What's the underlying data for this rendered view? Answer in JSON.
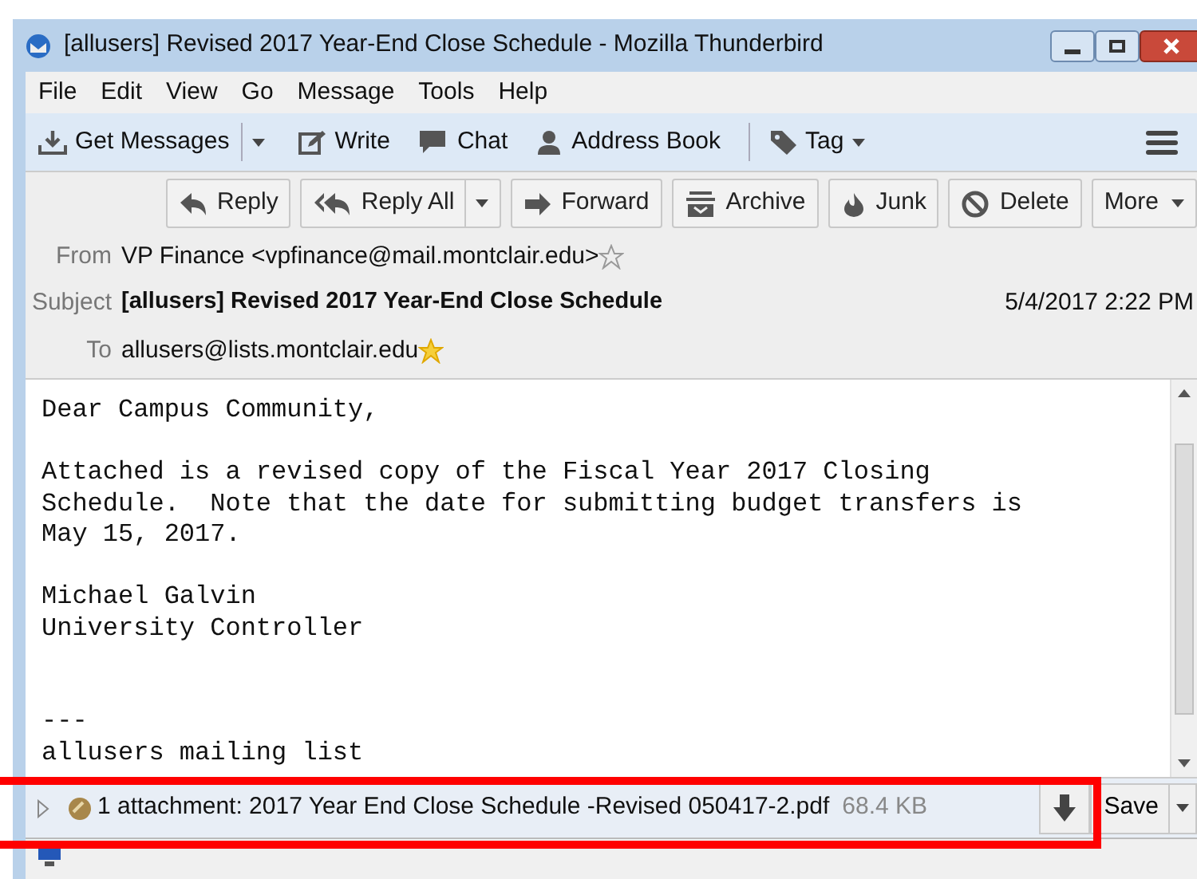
{
  "window": {
    "title": "[allusers] Revised 2017 Year-End Close Schedule - Mozilla Thunderbird"
  },
  "menu": [
    "File",
    "Edit",
    "View",
    "Go",
    "Message",
    "Tools",
    "Help"
  ],
  "toolbar": [
    {
      "kind": "get",
      "label": "Get Messages"
    },
    {
      "kind": "write",
      "label": "Write"
    },
    {
      "kind": "chat",
      "label": "Chat"
    },
    {
      "kind": "contacts",
      "label": "Address Book"
    },
    {
      "kind": "tag",
      "label": "Tag"
    }
  ],
  "actions": [
    {
      "kind": "reply",
      "label": "Reply"
    },
    {
      "kind": "replyall",
      "label": "Reply All"
    },
    {
      "kind": "forward",
      "label": "Forward"
    },
    {
      "kind": "archive",
      "label": "Archive"
    },
    {
      "kind": "junk",
      "label": "Junk"
    },
    {
      "kind": "delete",
      "label": "Delete"
    },
    {
      "kind": "more",
      "label": "More"
    }
  ],
  "headers": {
    "from_label": "From",
    "from": "VP Finance <vpfinance@mail.montclair.edu>",
    "from_starred": false,
    "subject_label": "Subject",
    "subject": "[allusers] Revised 2017 Year-End Close Schedule",
    "date": "5/4/2017 2:22 PM",
    "to_label": "To",
    "to": "allusers@lists.montclair.edu",
    "to_starred": true
  },
  "body": [
    {
      "kind": "text",
      "lines": [
        "Dear Campus Community,"
      ]
    },
    {
      "kind": "text",
      "lines": [
        "Attached is a revised copy of the Fiscal Year 2017 Closing",
        "Schedule.  Note that the date for submitting budget transfers is",
        "May 15, 2017."
      ]
    },
    {
      "kind": "text",
      "lines": [
        "Michael Galvin",
        "University Controller"
      ]
    },
    {
      "kind": "footer",
      "lines": [
        "---",
        "allusers mailing list"
      ]
    }
  ],
  "attachment": {
    "expanded": false,
    "summary": "1 attachment: 2017 Year End Close Schedule -Revised 050417-2.pdf",
    "size": "68.4 KB",
    "save_label": "Save"
  }
}
